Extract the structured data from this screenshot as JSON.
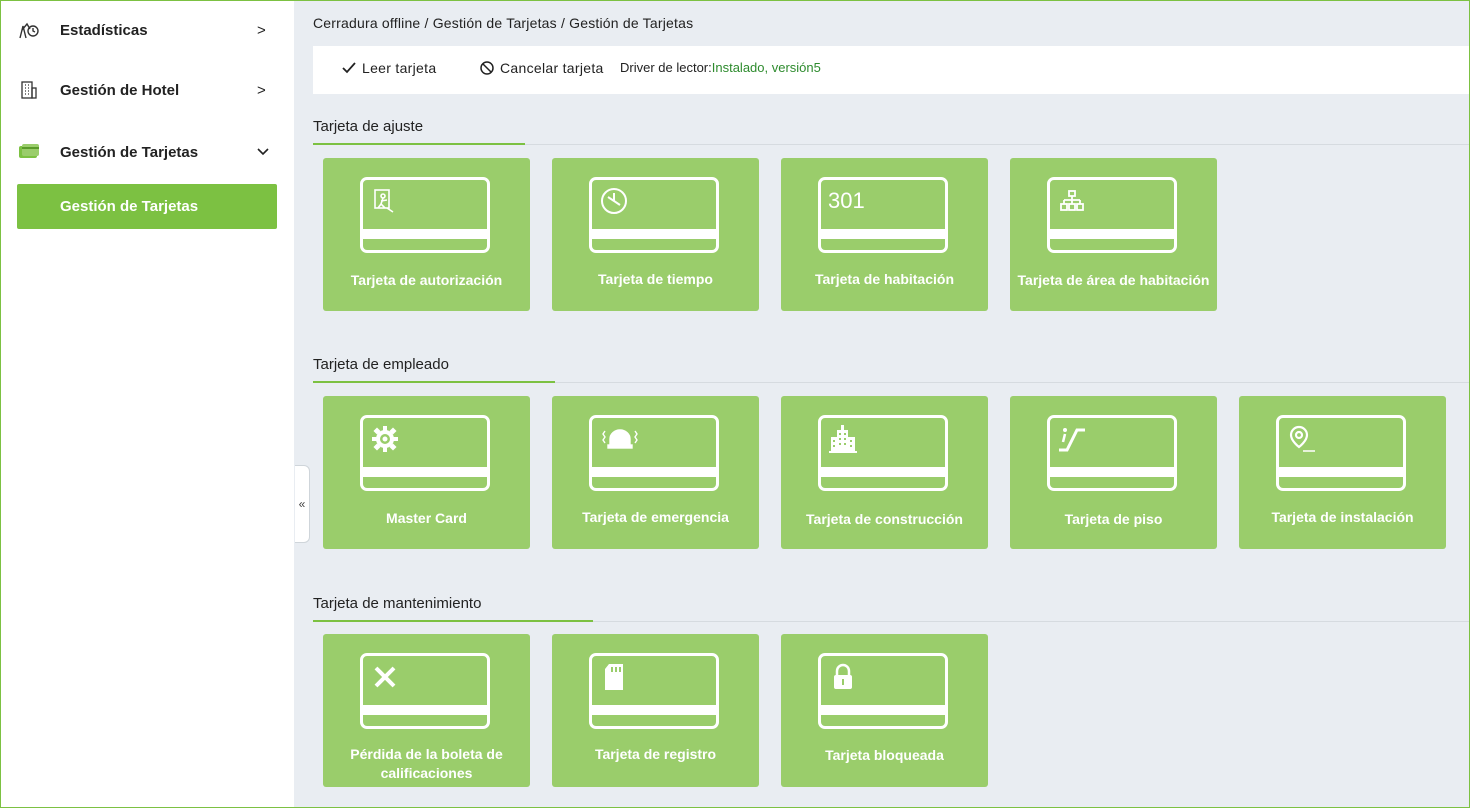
{
  "sidebar": {
    "items": [
      {
        "label": "Estadísticas",
        "icon": "statistics-icon",
        "chevron": ">"
      },
      {
        "label": "Gestión de Hotel",
        "icon": "hotel-building-icon",
        "chevron": ">"
      },
      {
        "label": "Gestión de Tarjetas",
        "icon": "card-management-icon",
        "chevron": "⌄"
      }
    ],
    "sub_item": "Gestión de Tarjetas",
    "collapse_label": "«"
  },
  "breadcrumb": "Cerradura offline / Gestión de Tarjetas / Gestión de Tarjetas",
  "toolbar": {
    "read_card": "Leer tarjeta",
    "cancel_card": "Cancelar tarjeta",
    "driver_label": "Driver de lector:",
    "driver_status": "Instalado, versión5"
  },
  "sections": [
    {
      "title": "Tarjeta de ajuste",
      "cards": [
        {
          "label": "Tarjeta de autorización",
          "icon": "authorization-icon"
        },
        {
          "label": "Tarjeta de tiempo",
          "icon": "clock-icon"
        },
        {
          "label": "Tarjeta de habitación",
          "icon": "room-number-icon",
          "icon_text": "301"
        },
        {
          "label": "Tarjeta de área de habitación",
          "icon": "hierarchy-icon"
        }
      ]
    },
    {
      "title": "Tarjeta de empleado",
      "cards": [
        {
          "label": "Master Card",
          "icon": "gear-icon"
        },
        {
          "label": "Tarjeta de emergencia",
          "icon": "alarm-icon"
        },
        {
          "label": "Tarjeta de construcción",
          "icon": "building-icon"
        },
        {
          "label": "Tarjeta de piso",
          "icon": "floor-icon"
        },
        {
          "label": "Tarjeta de instalación",
          "icon": "location-pin-icon"
        }
      ]
    },
    {
      "title": "Tarjeta de mantenimiento",
      "cards": [
        {
          "label": "Pérdida de la boleta de calificaciones",
          "icon": "close-x-icon"
        },
        {
          "label": "Tarjeta de registro",
          "icon": "sd-card-icon"
        },
        {
          "label": "Tarjeta bloqueada",
          "icon": "lock-icon"
        }
      ]
    }
  ],
  "colors": {
    "accent": "#7cc142",
    "card": "#9acd6b",
    "main_bg": "#e9edf2",
    "driver_ok": "#2e8b2e"
  }
}
